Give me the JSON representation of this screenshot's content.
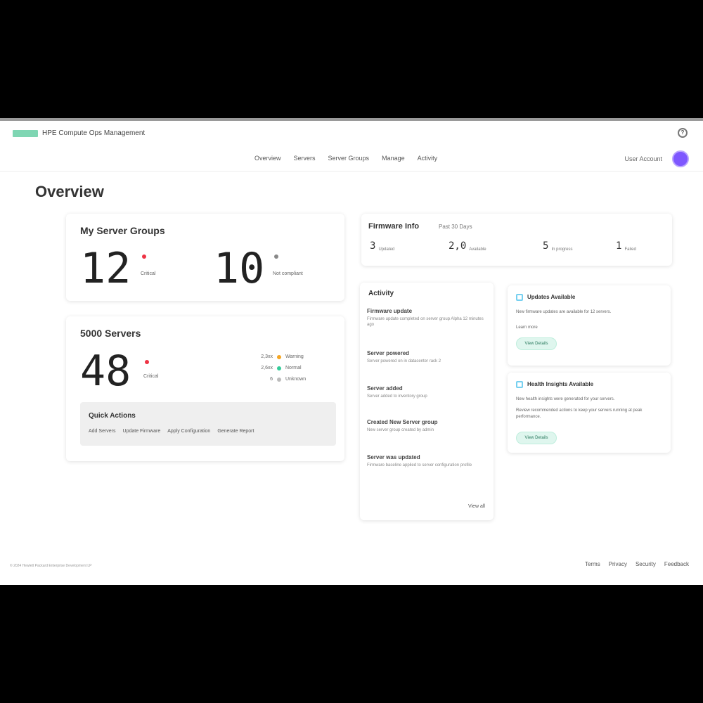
{
  "app": {
    "brand": "HPE Compute Ops Management"
  },
  "nav": {
    "items": [
      "Overview",
      "Servers",
      "Server Groups",
      "Manage",
      "Activity"
    ],
    "user": "User Account"
  },
  "page": {
    "title": "Overview"
  },
  "groups_card": {
    "title": "My Server Groups",
    "count": "12",
    "count_label": "Critical",
    "secondary_count": "10",
    "secondary_label": "Not compliant"
  },
  "servers_card": {
    "title": "5000 Servers",
    "count": "48",
    "count_label": "Critical",
    "legend": [
      {
        "num": "2,3xx",
        "label": "Warning",
        "color": "#f5a623"
      },
      {
        "num": "2,6xx",
        "label": "Normal",
        "color": "#33cc99"
      },
      {
        "num": "6",
        "label": "Unknown",
        "color": "#bbbbbb"
      }
    ],
    "quick_title": "Quick Actions",
    "quick_links": [
      "Add Servers",
      "Update Firmware",
      "Apply Configuration",
      "Generate Report"
    ]
  },
  "firmware_card": {
    "title": "Firmware Info",
    "subtitle": "Past 30 Days",
    "stats": [
      {
        "num": "3",
        "label": "Updated"
      },
      {
        "num": "2,0",
        "label": "Available"
      },
      {
        "num": "5",
        "label": "In progress"
      },
      {
        "num": "1",
        "label": "Failed"
      }
    ]
  },
  "activity_card": {
    "title": "Activity",
    "items": [
      {
        "head": "Firmware update",
        "desc": "Firmware update completed on server group Alpha 12 minutes ago"
      },
      {
        "head": "Server powered",
        "desc": "Server powered on in datacenter rack 2"
      },
      {
        "head": "Server added",
        "desc": "Server added to inventory group"
      },
      {
        "head": "Created New Server group",
        "desc": "New server group created by admin"
      },
      {
        "head": "Server was updated",
        "desc": "Firmware baseline applied to server configuration profile"
      }
    ],
    "more": "View all"
  },
  "notices": [
    {
      "title": "Updates Available",
      "desc": "New firmware updates are available for 12 servers.",
      "desc2": "Learn more",
      "button": "View Details"
    },
    {
      "title": "Health Insights Available",
      "desc": "New health insights were generated for your servers.",
      "desc2": "Review recommended actions to keep your servers running at peak performance.",
      "button": "View Details"
    }
  ],
  "footer": {
    "copyright": "© 2024 Hewlett Packard Enterprise Development LP",
    "links": [
      "Terms",
      "Privacy",
      "Security",
      "Feedback"
    ]
  }
}
